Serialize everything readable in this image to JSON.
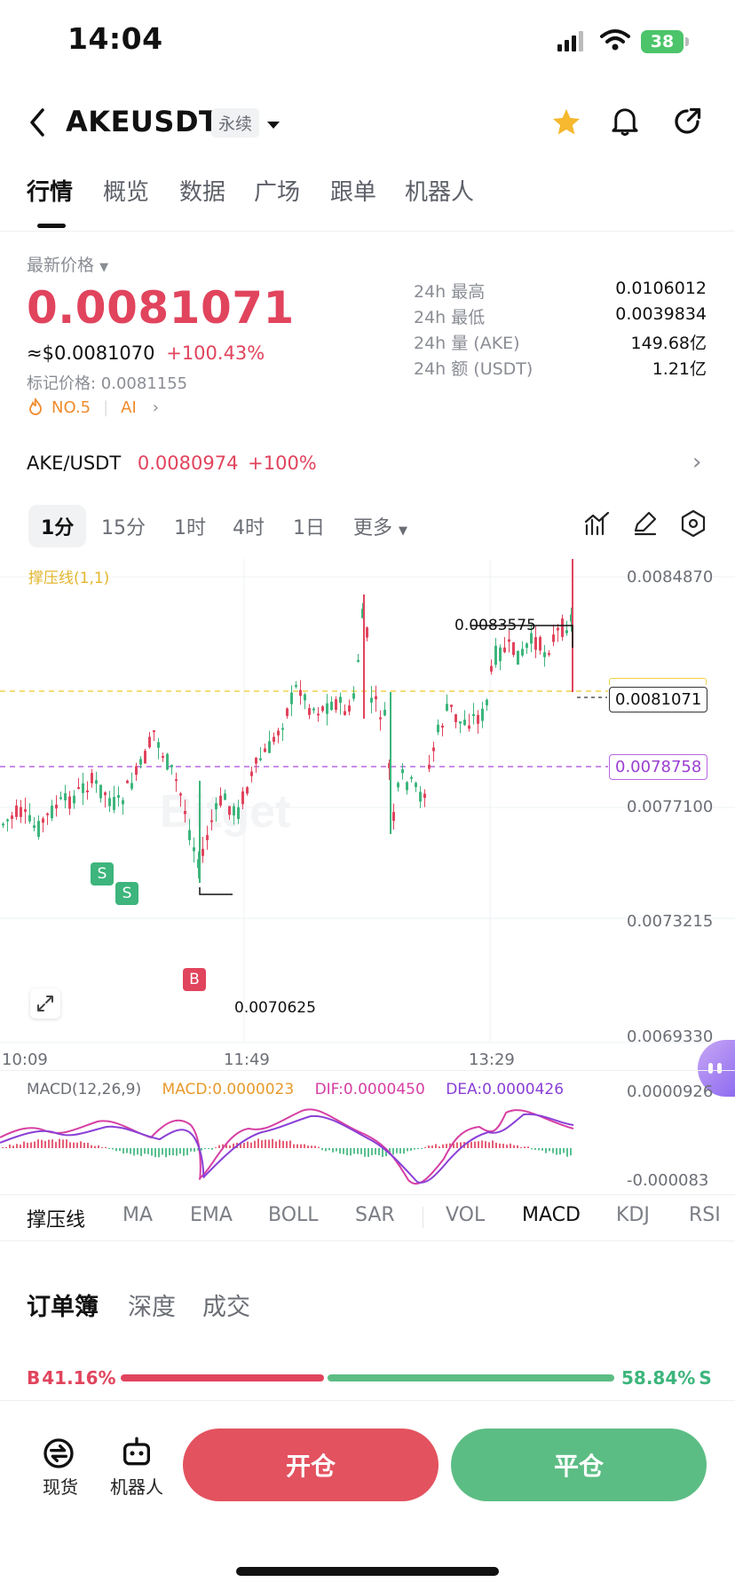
{
  "status": {
    "time": "14:04",
    "battery": "38"
  },
  "header": {
    "pair": "AKEUSDT",
    "type_badge": "永续"
  },
  "tabs": [
    "行情",
    "概览",
    "数据",
    "广场",
    "跟单",
    "机器人"
  ],
  "price_block": {
    "label": "最新价格",
    "last_price": "0.0081071",
    "usd_price": "≈$0.0081070",
    "change": "+100.43%",
    "mark_price": "标记价格: 0.0081155",
    "rank": "NO.5",
    "ai": "AI"
  },
  "stats": [
    {
      "label": "24h  最高",
      "value": "0.0106012"
    },
    {
      "label": "24h  最低",
      "value": "0.0039834"
    },
    {
      "label": "24h  量 (AKE)",
      "value": "149.68亿"
    },
    {
      "label": "24h  额 (USDT)",
      "value": "1.21亿"
    }
  ],
  "spot": {
    "pair": "AKE/USDT",
    "price": "0.0080974",
    "change": "+100%"
  },
  "timeframes": [
    "1分",
    "15分",
    "1时",
    "4时",
    "1日",
    "更多"
  ],
  "chart": {
    "indicator_label": "撑压线(1,1)",
    "y_labels": [
      "0.0084870",
      "0.0077100",
      "0.0073215",
      "0.0069330"
    ],
    "high_marker": "0.0083575",
    "low_marker": "0.0070625",
    "current_price_tag": "0.0081071",
    "support_tag": "0.0078758",
    "x_labels": [
      "10:09",
      "11:49",
      "13:29"
    ],
    "sell_marker": "S",
    "buy_marker": "B"
  },
  "macd": {
    "params": "MACD(12,26,9)",
    "macd": "MACD:0.0000023",
    "dif": "DIF:0.0000450",
    "dea": "DEA:0.0000426",
    "y_top": "0.0000926",
    "y_bottom": "-0.000083"
  },
  "indicator_tabs": [
    "撑压线",
    "MA",
    "EMA",
    "BOLL",
    "SAR",
    "VOL",
    "MACD",
    "KDJ",
    "RSI"
  ],
  "orderbook_tabs": [
    "订单簿",
    "深度",
    "成交"
  ],
  "ratio": {
    "buy_label": "B",
    "buy": "41.16%",
    "sell": "58.84%",
    "sell_label": "S",
    "buy_fraction": 0.4116
  },
  "bottom_nav": {
    "spot": "现货",
    "robot": "机器人",
    "open": "开仓",
    "close": "平仓"
  },
  "colors": {
    "up": "#e1445d",
    "down": "#3db57c",
    "accent_yellow": "#f2b630"
  }
}
